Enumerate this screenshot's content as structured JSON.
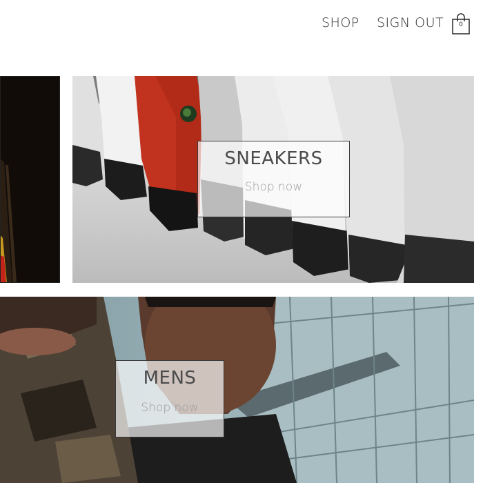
{
  "header": {
    "nav": {
      "shop_label": "SHOP",
      "signout_label": "SIGN OUT"
    },
    "cart": {
      "icon": "shopping-bag-icon",
      "count": "0"
    }
  },
  "categories": {
    "sneakers": {
      "title": "SNEAKERS",
      "subtitle": "Shop now"
    },
    "mens": {
      "title": "MENS",
      "subtitle": "Shop now"
    }
  },
  "colors": {
    "text": "#2a2a2a",
    "card_overlay": "#ffffffad",
    "border": "#222222"
  }
}
